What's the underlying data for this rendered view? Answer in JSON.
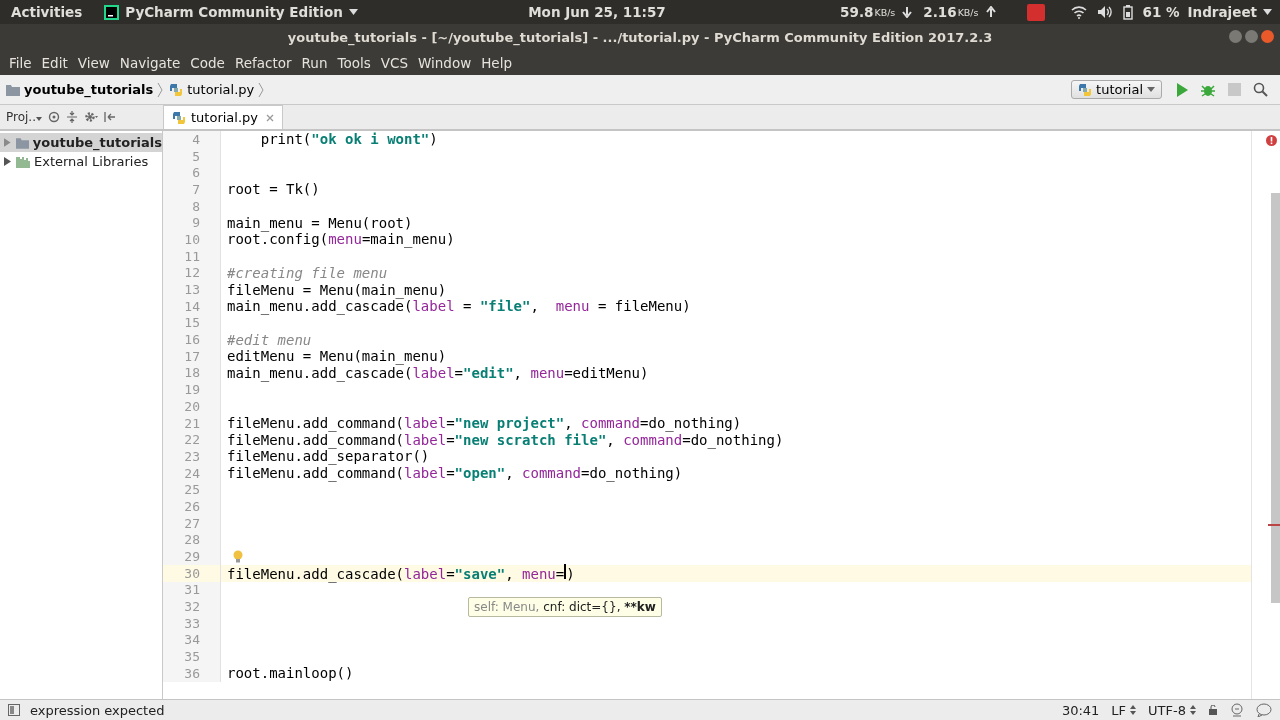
{
  "top_bar": {
    "activities": "Activities",
    "app_menu": "PyCharm Community Edition",
    "clock": "Mon Jun 25, 11:57",
    "download_speed": "59.8",
    "download_unit": "KB/s",
    "upload_speed": "2.16",
    "upload_unit": "KB/s",
    "battery": "61 %",
    "user": "Indrajeet"
  },
  "window": {
    "title": "youtube_tutorials - [~/youtube_tutorials] - .../tutorial.py - PyCharm Community Edition 2017.2.3"
  },
  "menu": [
    "File",
    "Edit",
    "View",
    "Navigate",
    "Code",
    "Refactor",
    "Run",
    "Tools",
    "VCS",
    "Window",
    "Help"
  ],
  "breadcrumbs": [
    {
      "label": "youtube_tutorials",
      "kind": "folder"
    },
    {
      "label": "tutorial.py",
      "kind": "file"
    }
  ],
  "run_config": "tutorial",
  "project_panel": {
    "title": "Proj..",
    "tree": [
      {
        "label": "youtube_tutorials",
        "kind": "folder",
        "selected": true
      },
      {
        "label": "External Libraries",
        "kind": "library",
        "selected": false
      }
    ]
  },
  "editor": {
    "tab": {
      "label": "tutorial.py",
      "selected": true
    },
    "lines": [
      {
        "number": "4",
        "current": false,
        "tokens": [
          {
            "kind": "code",
            "text": "    print("
          },
          {
            "kind": "string",
            "text": "\"ok ok i wont\""
          },
          {
            "kind": "code",
            "text": ")"
          }
        ]
      },
      {
        "number": "5",
        "current": false
      },
      {
        "number": "6",
        "current": false
      },
      {
        "number": "7",
        "current": false,
        "tokens": [
          {
            "kind": "code",
            "text": "root = Tk()"
          }
        ]
      },
      {
        "number": "8",
        "current": false
      },
      {
        "number": "9",
        "current": false,
        "tokens": [
          {
            "kind": "code",
            "text": "main_menu = Menu(root)"
          }
        ]
      },
      {
        "number": "10",
        "current": false,
        "tokens": [
          {
            "kind": "code",
            "text": "root.config("
          },
          {
            "kind": "arg",
            "text": "menu"
          },
          {
            "kind": "code",
            "text": "=main_menu)"
          }
        ]
      },
      {
        "number": "11",
        "current": false
      },
      {
        "number": "12",
        "current": false,
        "tokens": [
          {
            "kind": "comment",
            "text": "#creating file menu"
          }
        ]
      },
      {
        "number": "13",
        "current": false,
        "tokens": [
          {
            "kind": "code",
            "text": "fileMenu = Menu(main_menu)"
          }
        ]
      },
      {
        "number": "14",
        "current": false,
        "tokens": [
          {
            "kind": "code",
            "text": "main_menu.add_cascade("
          },
          {
            "kind": "arg",
            "text": "label"
          },
          {
            "kind": "code",
            "text": " = "
          },
          {
            "kind": "string",
            "text": "\"file\""
          },
          {
            "kind": "code",
            "text": ",  "
          },
          {
            "kind": "arg",
            "text": "menu"
          },
          {
            "kind": "code",
            "text": " = fileMenu)"
          }
        ]
      },
      {
        "number": "15",
        "current": false
      },
      {
        "number": "16",
        "current": false,
        "tokens": [
          {
            "kind": "comment",
            "text": "#edit menu"
          }
        ]
      },
      {
        "number": "17",
        "current": false,
        "tokens": [
          {
            "kind": "code",
            "text": "editMenu = Menu(main_menu)"
          }
        ]
      },
      {
        "number": "18",
        "current": false,
        "tokens": [
          {
            "kind": "code",
            "text": "main_menu.add_cascade("
          },
          {
            "kind": "arg",
            "text": "label"
          },
          {
            "kind": "code",
            "text": "="
          },
          {
            "kind": "string",
            "text": "\"edit\""
          },
          {
            "kind": "code",
            "text": ", "
          },
          {
            "kind": "arg",
            "text": "menu"
          },
          {
            "kind": "code",
            "text": "=editMenu)"
          }
        ]
      },
      {
        "number": "19",
        "current": false
      },
      {
        "number": "20",
        "current": false
      },
      {
        "number": "21",
        "current": false,
        "tokens": [
          {
            "kind": "code",
            "text": "fileMenu.add_command("
          },
          {
            "kind": "arg",
            "text": "label"
          },
          {
            "kind": "code",
            "text": "="
          },
          {
            "kind": "string",
            "text": "\"new project\""
          },
          {
            "kind": "code",
            "text": ", "
          },
          {
            "kind": "arg",
            "text": "command"
          },
          {
            "kind": "code",
            "text": "=do_nothing)"
          }
        ]
      },
      {
        "number": "22",
        "current": false,
        "tokens": [
          {
            "kind": "code",
            "text": "fileMenu.add_command("
          },
          {
            "kind": "arg",
            "text": "label"
          },
          {
            "kind": "code",
            "text": "="
          },
          {
            "kind": "string",
            "text": "\"new scratch file\""
          },
          {
            "kind": "code",
            "text": ", "
          },
          {
            "kind": "arg",
            "text": "command"
          },
          {
            "kind": "code",
            "text": "=do_nothing)"
          }
        ]
      },
      {
        "number": "23",
        "current": false,
        "tokens": [
          {
            "kind": "code",
            "text": "fileMenu.add_separator()"
          }
        ]
      },
      {
        "number": "24",
        "current": false,
        "tokens": [
          {
            "kind": "code",
            "text": "fileMenu.add_command("
          },
          {
            "kind": "arg",
            "text": "label"
          },
          {
            "kind": "code",
            "text": "="
          },
          {
            "kind": "string",
            "text": "\"open\""
          },
          {
            "kind": "code",
            "text": ", "
          },
          {
            "kind": "arg",
            "text": "command"
          },
          {
            "kind": "code",
            "text": "=do_nothing)"
          }
        ]
      },
      {
        "number": "25",
        "current": false
      },
      {
        "number": "26",
        "current": false
      },
      {
        "number": "27",
        "current": false
      },
      {
        "number": "28",
        "current": false
      },
      {
        "number": "29",
        "current": false,
        "bulb": true
      },
      {
        "number": "30",
        "current": true,
        "tokens": [
          {
            "kind": "code",
            "text": "fileMenu.add_cascade("
          },
          {
            "kind": "arg",
            "text": "label"
          },
          {
            "kind": "code",
            "text": "="
          },
          {
            "kind": "string",
            "text": "\"save\""
          },
          {
            "kind": "code",
            "text": ", "
          },
          {
            "kind": "arg",
            "text": "menu"
          },
          {
            "kind": "code",
            "text": "="
          },
          {
            "kind": "caret"
          },
          {
            "kind": "code",
            "text": ")"
          }
        ]
      },
      {
        "number": "31",
        "current": false
      },
      {
        "number": "32",
        "current": false
      },
      {
        "number": "33",
        "current": false
      },
      {
        "number": "34",
        "current": false
      },
      {
        "number": "35",
        "current": false
      },
      {
        "number": "36",
        "current": false,
        "tokens": [
          {
            "kind": "code",
            "text": "root.mainloop()"
          }
        ]
      }
    ],
    "param_hint": [
      {
        "text": "self: Menu, ",
        "bold": false,
        "dim": true
      },
      {
        "text": "cnf: dict={}, ",
        "bold": false,
        "dim": false
      },
      {
        "text": "**kw",
        "bold": true,
        "dim": false
      }
    ]
  },
  "status_bar": {
    "message": "expression expected",
    "position": "30:41",
    "line_separator": "LF",
    "encoding": "UTF-8"
  }
}
